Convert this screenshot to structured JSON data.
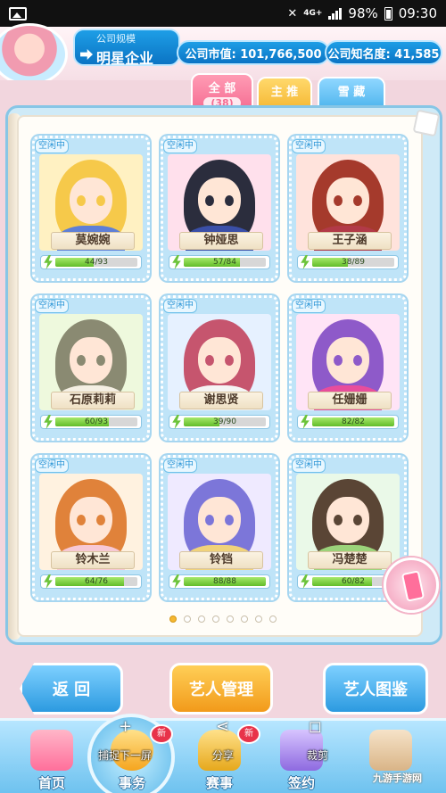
{
  "status_bar": {
    "network": "4G+",
    "battery": "98%",
    "time": "09:30"
  },
  "company": {
    "label": "公司规模",
    "type": "明星企业",
    "market_value": "公司市值: 101,766,500",
    "fame": "公司知名度: 41,585"
  },
  "tabs": [
    {
      "label": "全 部",
      "count": "(38)"
    },
    {
      "label": "主 推"
    },
    {
      "label": "雪 藏"
    }
  ],
  "cards": [
    {
      "status": "空闲中",
      "name": "莫婉婉",
      "stamina": "44/93",
      "fill": 0.47
    },
    {
      "status": "空闲中",
      "name": "钟娅思",
      "stamina": "57/84",
      "fill": 0.68
    },
    {
      "status": "空闲中",
      "name": "王子涵",
      "stamina": "38/89",
      "fill": 0.43
    },
    {
      "status": "空闲中",
      "name": "石原莉莉",
      "stamina": "60/93",
      "fill": 0.65
    },
    {
      "status": "空闲中",
      "name": "谢思贤",
      "stamina": "39/90",
      "fill": 0.43
    },
    {
      "status": "空闲中",
      "name": "任姗姗",
      "stamina": "82/82",
      "fill": 1.0
    },
    {
      "status": "空闲中",
      "name": "铃木兰",
      "stamina": "64/76",
      "fill": 0.84
    },
    {
      "status": "空闲中",
      "name": "铃铛",
      "stamina": "88/88",
      "fill": 1.0
    },
    {
      "status": "空闲中",
      "name": "冯楚楚",
      "stamina": "60/82",
      "fill": 0.73
    }
  ],
  "pagination": {
    "total": 8,
    "current": 1
  },
  "buttons": {
    "back": "返 回",
    "manage": "艺人管理",
    "guide": "艺人图鉴"
  },
  "nav": [
    {
      "label": "首页"
    },
    {
      "label": "事务"
    },
    {
      "label": "赛事"
    },
    {
      "label": "签约"
    },
    {
      "label": ""
    }
  ],
  "badges": {
    "new": "新"
  },
  "overlay": {
    "hint1": "捕捉下一屏",
    "hint2": "分享",
    "hint3": "裁剪"
  },
  "watermark": "九游手游网",
  "colors": {
    "accent_blue": "#1e9ee6",
    "accent_orange": "#f29a1a",
    "stamina_green": "#62bd2a",
    "badge_red": "#e8334a"
  }
}
